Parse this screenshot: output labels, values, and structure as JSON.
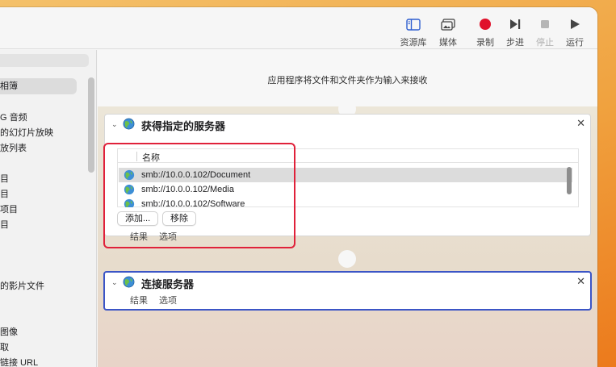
{
  "toolbar": {
    "library_label": "资源库",
    "media_label": "媒体",
    "record_label": "录制",
    "step_label": "步进",
    "stop_label": "停止",
    "run_label": "运行",
    "record_color": "#e0112b"
  },
  "sidebar": {
    "items": [
      {
        "label": "相簿"
      },
      {
        "label": "G 音频"
      },
      {
        "label": "的幻灯片放映"
      },
      {
        "label": "放列表"
      },
      {
        "label": "目"
      },
      {
        "label": "目"
      },
      {
        "label": "项目"
      },
      {
        "label": "目"
      },
      {
        "label": "的影片文件"
      },
      {
        "label": "图像"
      },
      {
        "label": "取"
      },
      {
        "label": "链接 URL"
      }
    ]
  },
  "workflow": {
    "input_info": "应用程序将文件和文件夹作为输入来接收"
  },
  "actions": [
    {
      "title": "获得指定的服务器",
      "column_header": "名称",
      "servers": [
        "smb://10.0.0.102/Document",
        "smb://10.0.0.102/Media",
        "smb://10.0.0.102/Software"
      ],
      "add_button": "添加...",
      "remove_button": "移除",
      "tab_results": "结果",
      "tab_options": "选项"
    },
    {
      "title": "连接服务器",
      "tab_results": "结果",
      "tab_options": "选项"
    }
  ],
  "colors": {
    "selection_border": "#3b55c6",
    "annotation": "#e0213a"
  }
}
